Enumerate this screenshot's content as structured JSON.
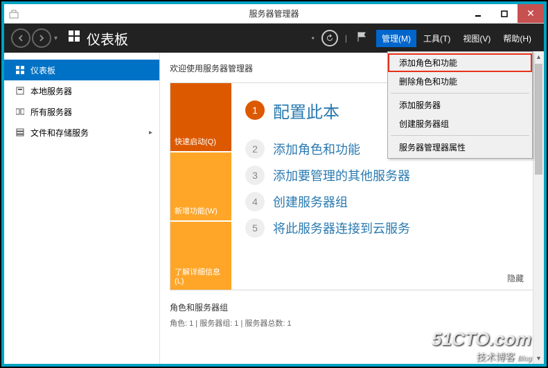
{
  "title_bar": {
    "title": "服务器管理器"
  },
  "header": {
    "page_title": "仪表板",
    "menu": {
      "manage": "管理(M)",
      "tools": "工具(T)",
      "view": "视图(V)",
      "help": "帮助(H)"
    }
  },
  "dropdown": {
    "items": [
      "添加角色和功能",
      "删除角色和功能",
      "添加服务器",
      "创建服务器组",
      "服务器管理器属性"
    ]
  },
  "sidebar": {
    "items": [
      {
        "label": "仪表板"
      },
      {
        "label": "本地服务器"
      },
      {
        "label": "所有服务器"
      },
      {
        "label": "文件和存储服务"
      }
    ]
  },
  "main": {
    "welcome": "欢迎使用服务器管理器",
    "left_tabs": {
      "quick_start": "快速启动(Q)",
      "whats_new": "新增功能(W)",
      "learn_more": "了解详细信息(L)"
    },
    "steps": [
      {
        "num": "1",
        "text": "配置此本"
      },
      {
        "num": "2",
        "text": "添加角色和功能"
      },
      {
        "num": "3",
        "text": "添加要管理的其他服务器"
      },
      {
        "num": "4",
        "text": "创建服务器组"
      },
      {
        "num": "5",
        "text": "将此服务器连接到云服务"
      }
    ],
    "hide": "隐藏",
    "groups": {
      "title": "角色和服务器组",
      "subtitle": "角色: 1 | 服务器组: 1 | 服务器总数: 1"
    }
  },
  "watermark": {
    "line1": "51CTO.com",
    "line2": "技术博客",
    "blog": "Blog"
  }
}
